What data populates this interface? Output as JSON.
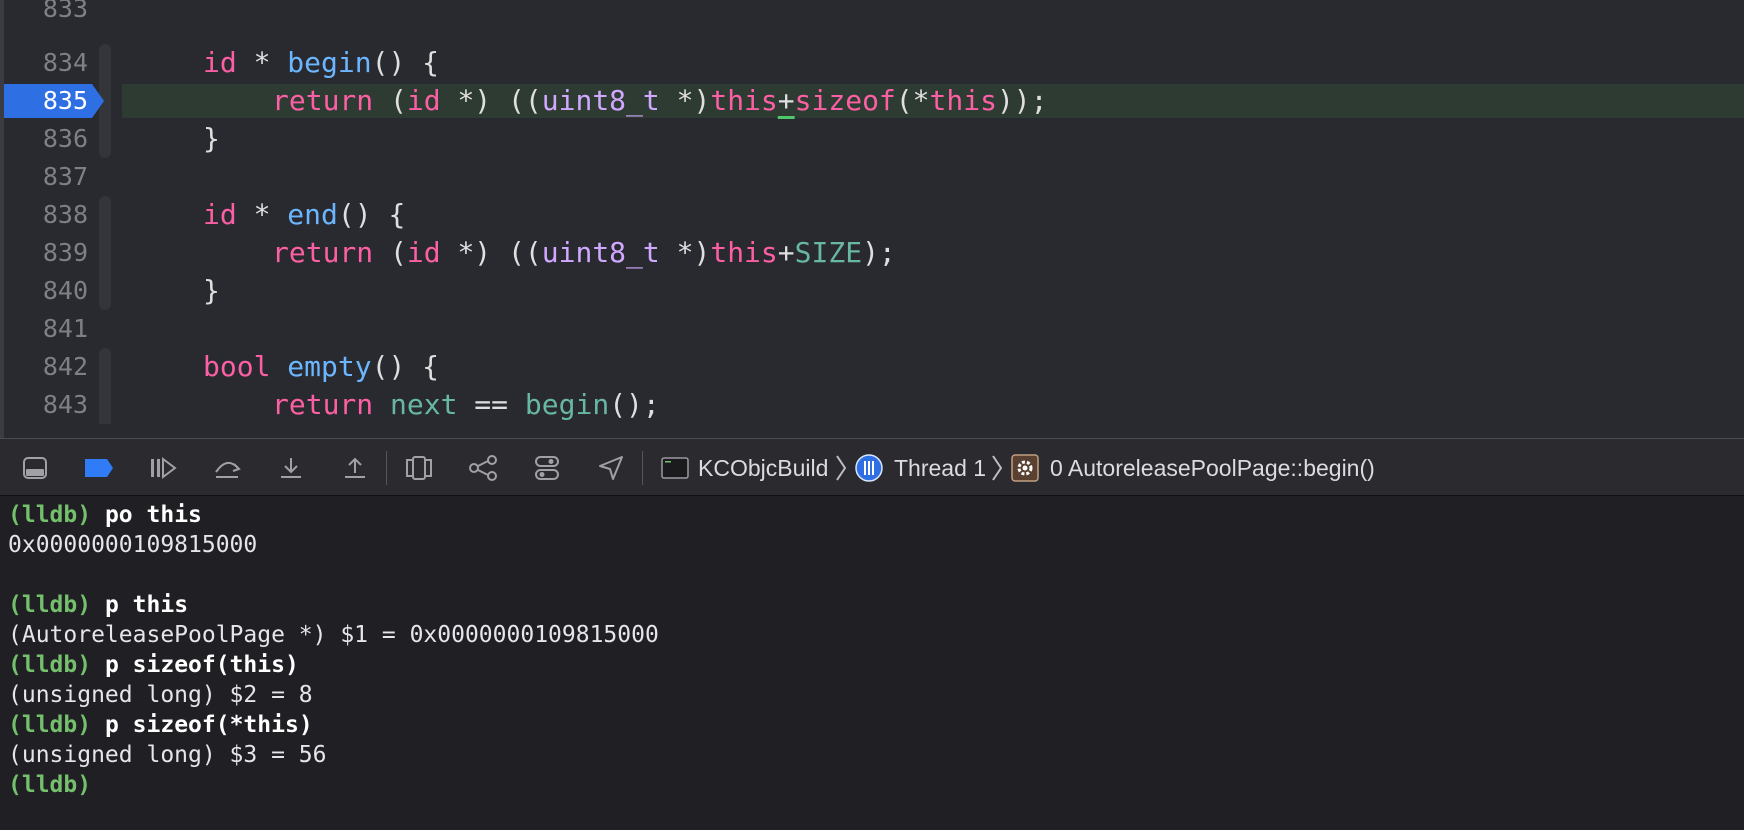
{
  "editor": {
    "lines": [
      {
        "num": "833"
      },
      {
        "num": "834"
      },
      {
        "num": "835",
        "current": true
      },
      {
        "num": "836"
      },
      {
        "num": "837"
      },
      {
        "num": "838"
      },
      {
        "num": "839"
      },
      {
        "num": "840"
      },
      {
        "num": "841"
      },
      {
        "num": "842"
      },
      {
        "num": "843"
      }
    ],
    "code": {
      "l834": [
        "id",
        " * ",
        "begin",
        "() {"
      ],
      "l835": [
        "return",
        " (",
        "id",
        " *) ((",
        "uint8_t",
        " *)",
        "this",
        "+",
        "sizeof",
        "(*",
        "this",
        "));"
      ],
      "l836": [
        "}"
      ],
      "l838": [
        "id",
        " * ",
        "end",
        "() {"
      ],
      "l839": [
        "return",
        " (",
        "id",
        " *) ((",
        "uint8_t",
        " *)",
        "this",
        "+",
        "SIZE",
        ");"
      ],
      "l840": [
        "}"
      ],
      "l842": [
        "bool",
        " ",
        "empty",
        "() {"
      ],
      "l843": [
        "return",
        " ",
        "next",
        " == ",
        "begin",
        "();"
      ]
    },
    "colors": {
      "keyword": "#fc5fa3",
      "type": "#d0a8ff",
      "function": "#67b7a4",
      "breakpoint": "#2f6fe4",
      "current_line": "#2e3b32"
    }
  },
  "toolbar": {
    "icons": [
      "hide-debug-area-icon",
      "breakpoints-icon",
      "continue-icon",
      "step-over-icon",
      "step-into-icon",
      "step-out-icon",
      "view-hierarchy-icon",
      "memory-graph-icon",
      "environment-overrides-icon",
      "simulate-location-icon"
    ],
    "breadcrumb": {
      "target": "KCObjcBuild",
      "thread": "Thread 1",
      "frame": "0 AutoreleasePoolPage::begin()"
    }
  },
  "console": {
    "prompt": "(lldb)",
    "entries": [
      {
        "cmd": "po this",
        "out": [
          "0x0000000109815000",
          ""
        ]
      },
      {
        "cmd": "p this",
        "out": [
          "(AutoreleasePoolPage *) $1 = 0x0000000109815000"
        ]
      },
      {
        "cmd": "p sizeof(this)",
        "out": [
          "(unsigned long) $2 = 8"
        ]
      },
      {
        "cmd": "p sizeof(*this)",
        "out": [
          "(unsigned long) $3 = 56"
        ]
      }
    ]
  }
}
